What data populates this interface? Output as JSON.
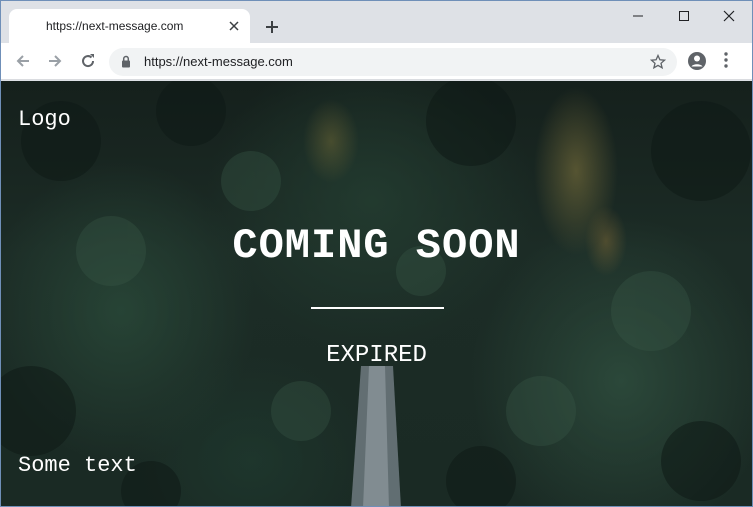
{
  "browser": {
    "tab": {
      "title": "https://next-message.com"
    },
    "address_bar": {
      "url": "https://next-message.com"
    },
    "icons": [
      "close-tab-icon",
      "new-tab-icon",
      "minimize-icon",
      "maximize-icon",
      "window-close-icon",
      "back-arrow-icon",
      "forward-arrow-icon",
      "reload-icon",
      "lock-icon",
      "star-icon",
      "account-icon",
      "menu-dots-icon"
    ]
  },
  "page": {
    "logo": "Logo",
    "headline": "COMING SOON",
    "status": "EXPIRED",
    "footer_text": "Some text",
    "colors": {
      "text": "#ffffff",
      "background": "#1a2a24"
    }
  }
}
